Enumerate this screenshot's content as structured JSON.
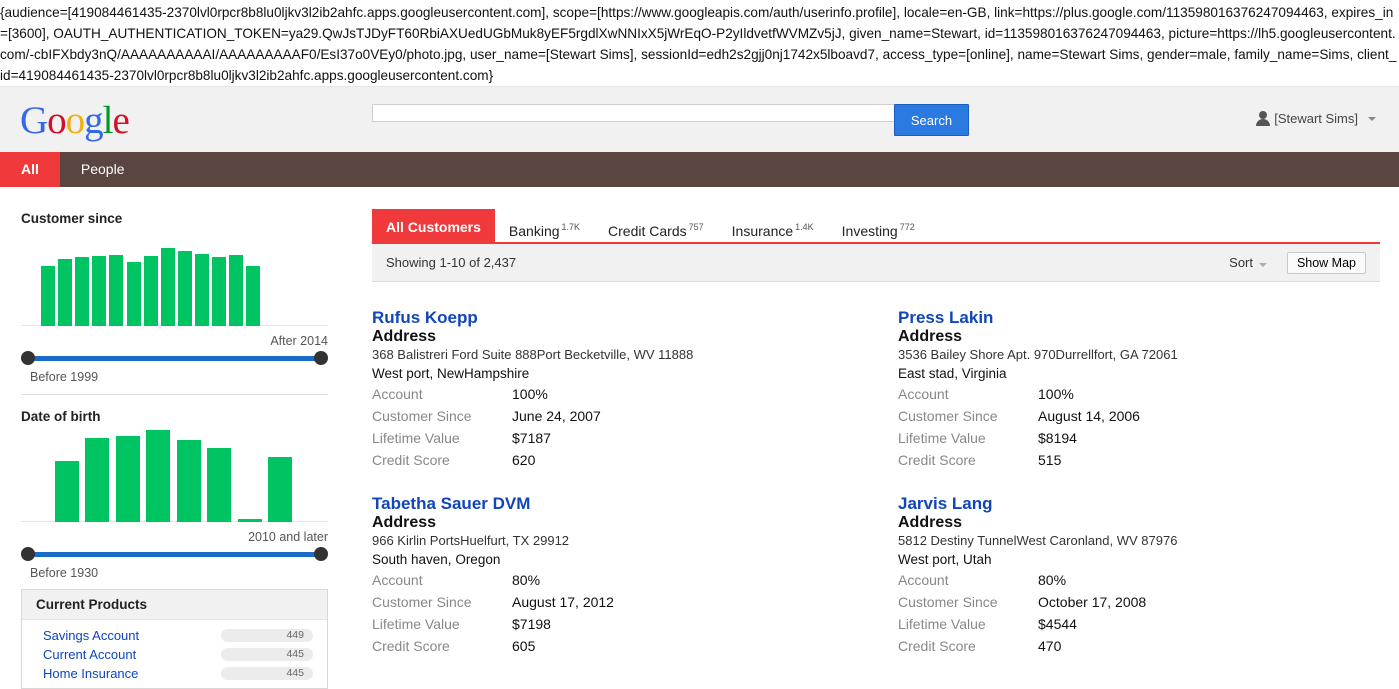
{
  "debug_output": "{audience=[419084461435-2370lvl0rpcr8b8lu0ljkv3l2ib2ahfc.apps.googleusercontent.com], scope=[https://www.googleapis.com/auth/userinfo.profile], locale=en-GB, link=https://plus.google.com/113598016376247094463, expires_in=[3600], OAUTH_AUTHENTICATION_TOKEN=ya29.QwJsTJDyFT60RbiAXUedUGbMuk8yEF5rgdlXwNNIxX5jWrEqO-P2yIldvetfWVMZv5jJ, given_name=Stewart, id=113598016376247094463, picture=https://lh5.googleusercontent.com/-cbIFXbdy3nQ/AAAAAAAAAAI/AAAAAAAAAF0/EsI37o0VEy0/photo.jpg, user_name=[Stewart Sims], sessionId=edh2s2gjj0nj1742x5lboavd7, access_type=[online], name=Stewart Sims, gender=male, family_name=Sims, client_id=419084461435-2370lvl0rpcr8b8lu0ljkv3l2ib2ahfc.apps.googleusercontent.com}",
  "header": {
    "logo_letters": [
      {
        "ch": "G",
        "color": "#3369e8"
      },
      {
        "ch": "o",
        "color": "#d50f25"
      },
      {
        "ch": "o",
        "color": "#eeb211"
      },
      {
        "ch": "g",
        "color": "#3369e8"
      },
      {
        "ch": "l",
        "color": "#009925"
      },
      {
        "ch": "e",
        "color": "#d50f25"
      }
    ],
    "search_value": "",
    "search_button": "Search",
    "user_label": "[Stewart Sims]"
  },
  "nav": {
    "items": [
      "All",
      "People"
    ],
    "active": 0
  },
  "sidebar": {
    "customer_since": {
      "title": "Customer since",
      "bars": [
        0.62,
        0.7,
        0.72,
        0.73,
        0.74,
        0.67,
        0.73,
        0.81,
        0.78,
        0.75,
        0.72,
        0.74,
        0.62
      ],
      "max_label": "After 2014",
      "min_label": "Before 1999"
    },
    "date_of_birth": {
      "title": "Date of birth",
      "bars": [
        0.0,
        0.66,
        0.91,
        0.93,
        1.0,
        0.89,
        0.8,
        0.03,
        0.71
      ],
      "max_label": "2010 and later",
      "min_label": "Before 1930"
    },
    "current_products": {
      "title": "Current Products",
      "items": [
        {
          "label": "Savings Account",
          "count": "449"
        },
        {
          "label": "Current Account",
          "count": "445"
        },
        {
          "label": "Home Insurance",
          "count": "445"
        }
      ]
    }
  },
  "main": {
    "tabs": [
      {
        "label": "All Customers",
        "count": ""
      },
      {
        "label": "Banking",
        "count": "1.7K"
      },
      {
        "label": "Credit Cards",
        "count": "757"
      },
      {
        "label": "Insurance",
        "count": "1.4K"
      },
      {
        "label": "Investing",
        "count": "772"
      }
    ],
    "showing": "Showing 1-10 of 2,437",
    "sort_label": "Sort",
    "show_map": "Show Map",
    "field_labels": {
      "address": "Address",
      "account": "Account",
      "customer_since": "Customer Since",
      "lifetime_value": "Lifetime Value",
      "credit_score": "Credit Score"
    },
    "customers": [
      {
        "name": "Rufus Koepp",
        "address_line1": "368 Balistreri Ford Suite 888Port Becketville, WV 11888",
        "address_line2": "West port, NewHampshire",
        "account": "100%",
        "customer_since": "June 24, 2007",
        "lifetime_value": "$7187",
        "credit_score": "620"
      },
      {
        "name": "Press Lakin",
        "address_line1": "3536 Bailey Shore Apt. 970Durrellfort, GA 72061",
        "address_line2": "East stad, Virginia",
        "account": "100%",
        "customer_since": "August 14, 2006",
        "lifetime_value": "$8194",
        "credit_score": "515"
      },
      {
        "name": "Tabetha Sauer DVM",
        "address_line1": "966 Kirlin PortsHuelfurt, TX 29912",
        "address_line2": "South haven, Oregon",
        "account": "80%",
        "customer_since": "August 17, 2012",
        "lifetime_value": "$7198",
        "credit_score": "605"
      },
      {
        "name": "Jarvis Lang",
        "address_line1": "5812 Destiny TunnelWest Caronland, WV 87976",
        "address_line2": "West port, Utah",
        "account": "80%",
        "customer_since": "October 17, 2008",
        "lifetime_value": "$4544",
        "credit_score": "470"
      }
    ]
  },
  "colors": {
    "accent_red": "#f0393a",
    "nav_brown": "#5a4541",
    "bar_green": "#00c462",
    "slider_blue": "#1a6bc9",
    "link_blue": "#1046b8"
  }
}
